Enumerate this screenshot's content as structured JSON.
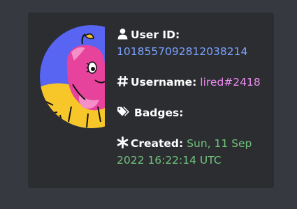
{
  "profile": {
    "user_id_label": "User ID:",
    "user_id_value": "1018557092812038214",
    "username_label": "Username:",
    "username_value": "lired#2418",
    "badges_label": "Badges:",
    "created_label": "Created:",
    "created_value_line1": "Sun, 11 Sep",
    "created_value_line2": "2022 16:22:14 UTC"
  },
  "icons": {
    "user": "user-icon",
    "hashtag": "hashtag-icon",
    "badges": "tags-icon",
    "created": "asterisk-icon",
    "avatar": "avatar-image"
  },
  "colors": {
    "page_bg": "#36393f",
    "card_bg": "#2b2d31",
    "label": "#ffffff",
    "user_id": "#7aa2ff",
    "username": "#ef8cf1",
    "created": "#72c27d"
  }
}
